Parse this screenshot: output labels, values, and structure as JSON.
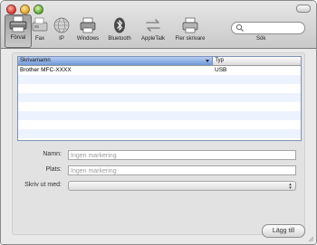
{
  "window": {
    "toolbar": [
      {
        "id": "default",
        "label": "Förval",
        "icon": "printer-default-icon",
        "selected": true
      },
      {
        "id": "fax",
        "label": "Fax",
        "icon": "fax-icon",
        "selected": false
      },
      {
        "id": "ip",
        "label": "IP",
        "icon": "globe-icon",
        "selected": false
      },
      {
        "id": "windows",
        "label": "Windows",
        "icon": "windows-printer-icon",
        "selected": false
      },
      {
        "id": "bluetooth",
        "label": "Bluetooth",
        "icon": "bluetooth-icon",
        "selected": false
      },
      {
        "id": "appletalk",
        "label": "AppleTalk",
        "icon": "appletalk-icon",
        "selected": false
      },
      {
        "id": "more",
        "label": "Fler skrivare",
        "icon": "printer-icon",
        "selected": false
      }
    ],
    "search": {
      "label": "Sök",
      "value": ""
    }
  },
  "table": {
    "columns": [
      "Skrivarnamn",
      "Typ"
    ],
    "rows": [
      {
        "name": "Brother MFC-XXXX",
        "type": "USB"
      }
    ]
  },
  "form": {
    "name_label": "Namn:",
    "name_placeholder": "Ingen markering",
    "location_label": "Plats:",
    "location_placeholder": "Ingen markering",
    "print_using_label": "Skriv ut med:",
    "print_using_value": ""
  },
  "actions": {
    "add_label": "Lägg till"
  },
  "colors": {
    "selection_header": "#6f98d6",
    "alt_row": "#edf3fe"
  }
}
